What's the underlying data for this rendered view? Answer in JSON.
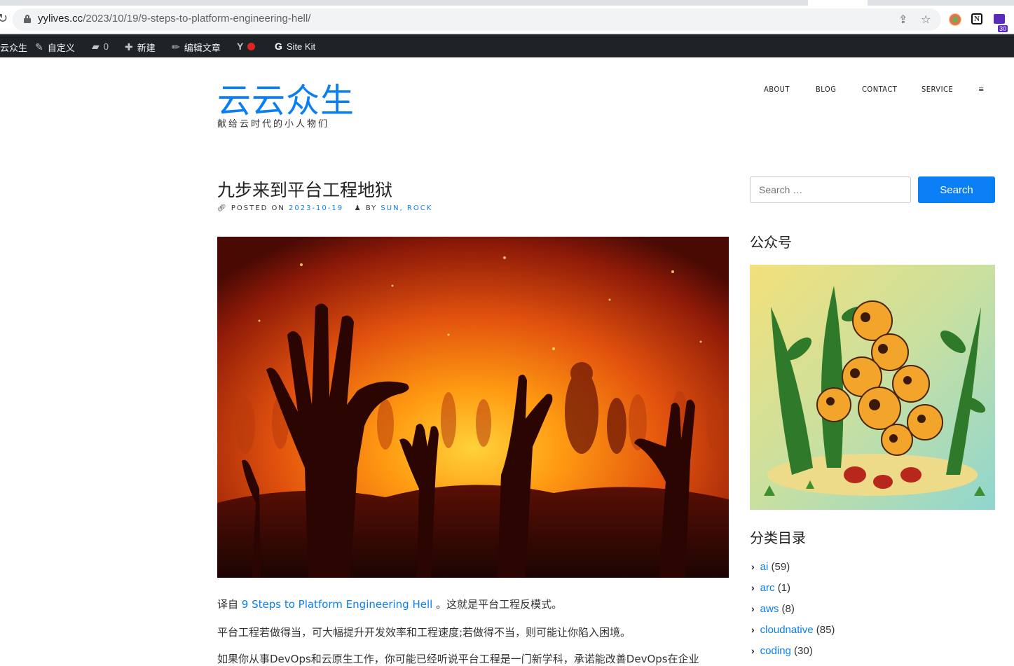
{
  "browser": {
    "url_host": "yylives.cc",
    "url_path": "/2023/10/19/9-steps-to-platform-engineering-hell/",
    "extension_badge": "30"
  },
  "adminbar": {
    "site_label": "云众生",
    "customize_label": "自定义",
    "comments_count": "0",
    "new_label": "新建",
    "edit_label": "编辑文章",
    "sitekit_label": "Site Kit"
  },
  "site": {
    "title": "云云众生",
    "description": "献给云时代的小人物们"
  },
  "nav": {
    "items": [
      "ABOUT",
      "BLOG",
      "CONTACT",
      "SERVICE",
      "≡"
    ]
  },
  "post": {
    "title": "九步来到平台工程地狱",
    "posted_on_label": "POSTED ON",
    "date": "2023-10-19",
    "by_label": "BY",
    "author": "SUN, ROCK",
    "p1_prefix": "译自 ",
    "p1_link": "9 Steps to Platform Engineering Hell",
    "p1_suffix": " 。这就是平台工程反模式。",
    "p2": "平台工程若做得当，可大幅提升开发效率和工程速度;若做得不当，则可能让你陷入困境。",
    "p3": "如果你从事DevOps和云原生工作，你可能已经听说平台工程是一门新学科，承诺能改善DevOps在企业"
  },
  "sidebar": {
    "search_placeholder": "Search …",
    "search_button": "Search",
    "gzh_title": "公众号",
    "categories_title": "分类目录",
    "categories": [
      {
        "name": "ai",
        "count": "(59)"
      },
      {
        "name": "arc",
        "count": "(1)"
      },
      {
        "name": "aws",
        "count": "(8)"
      },
      {
        "name": "cloudnative",
        "count": "(85)"
      },
      {
        "name": "coding",
        "count": "(30)"
      }
    ]
  }
}
